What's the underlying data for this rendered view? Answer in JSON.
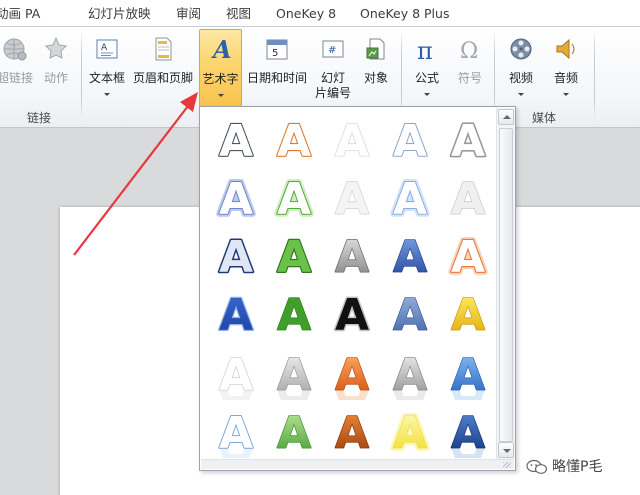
{
  "tabs": [
    "动画 PA",
    "幻灯片放映",
    "审阅",
    "视图",
    "OneKey 8",
    "OneKey 8 Plus"
  ],
  "ribbon": {
    "link_group": {
      "label": "链接",
      "buttons": [
        "超链接",
        "动作"
      ]
    },
    "text_group": {
      "buttons": {
        "textbox": "文本框",
        "header_footer": "页眉和页脚",
        "wordart": "艺术字",
        "datetime": "日期和时间",
        "slide_number_line1": "幻灯",
        "slide_number_line2": "片编号",
        "object": "对象"
      }
    },
    "symbol_group": {
      "buttons": [
        "公式",
        "符号"
      ]
    },
    "media_group": {
      "label": "媒体",
      "buttons": [
        "视频",
        "音频"
      ]
    }
  },
  "gallery": {
    "glyph": "A",
    "styles": [
      [
        "outline-gray",
        "outline-orange",
        "outline-faint",
        "outline-blue",
        "outline-gray-bold"
      ],
      [
        "glow-blue",
        "glow-green",
        "faint-gray",
        "glow-lightblue",
        "faint-gray-2"
      ],
      [
        "navy-bevel",
        "green-bevel",
        "gray-gradient",
        "blue-gradient",
        "orange-glow"
      ],
      [
        "blue-outline-glow",
        "solid-green",
        "black-white-outline",
        "blue-steel",
        "gold-gradient"
      ],
      [
        "reflect-white",
        "reflect-silver",
        "reflect-orange",
        "reflect-gray",
        "reflect-blue"
      ],
      [
        "light-blue-reflect",
        "green-stripe",
        "orange-brown",
        "yellow-glow",
        "dark-blue-3d"
      ]
    ]
  },
  "colors": {
    "accent_active": "#fcd46e",
    "annotation_arrow": "#e8383c"
  },
  "icons": {
    "hyperlink": "globe-link-icon",
    "action": "star-action-icon",
    "textbox": "textbox-icon",
    "header_footer": "page-icon",
    "wordart": "wordart-icon",
    "datetime": "calendar-icon",
    "slide_number": "hash-slide-icon",
    "object": "object-icon",
    "equation": "pi-icon",
    "symbol": "omega-icon",
    "video": "film-reel-icon",
    "audio": "speaker-icon"
  },
  "watermark": "略懂P毛"
}
